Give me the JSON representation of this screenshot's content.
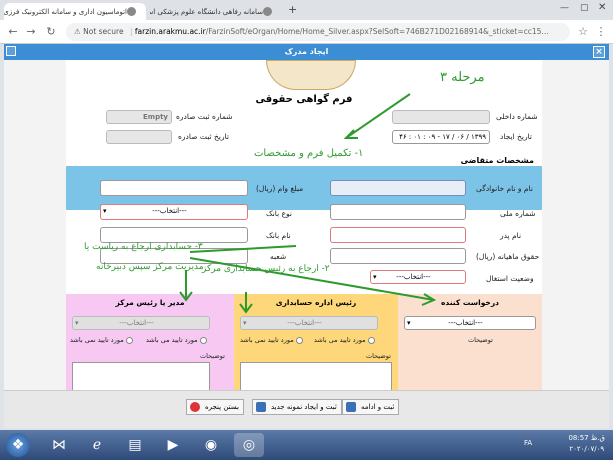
{
  "browser": {
    "tabs": [
      {
        "title": "اتوماسیون اداری و سامانه الکترونیک فرزی…",
        "active": true
      },
      {
        "title": "سامانه رفاهی دانشگاه علوم پزشکی استان م",
        "active": false
      }
    ],
    "new_tab_label": "+",
    "security_label": "Not secure",
    "url_domain": "farzin.arakmu.ac.ir",
    "url_path": "/FarzinSoft/eOrgan/Home/Home_Silver.aspx?SelSoft=746B271D02168914&_sticket=cc15…"
  },
  "dialog": {
    "title": "ایجاد مدرک",
    "form_title": "فرم گواهی حقوقی",
    "fields": {
      "internal_no_label": "شماره داخلی",
      "internal_no_value": "",
      "create_date_label": "تاریخ ایجاد",
      "create_date_value": "۱۳۹۹ / ۰۶ / ۱۷ - ۰۹ : ۰۱ : ۴۶",
      "outgoing_no_label": "شماره ثبت صادره",
      "outgoing_no_value": "Empty",
      "outgoing_date_label": "تاریخ ثبت صادره",
      "outgoing_date_value": ""
    },
    "applicant_section_title": "مشخصات متقاضی",
    "applicant": {
      "name_label": "نام و نام خانوادگی",
      "national_id_label": "شماره ملی",
      "father_label": "نام پدر",
      "salary_label": "حقوق ماهیانه (ریال)",
      "employment_label": "وضعیت استغال",
      "employment_value": "---انتخاب---",
      "loan_label": "مبلغ وام (ریال)",
      "bank_type_label": "نوع بانک",
      "bank_type_value": "---انتخاب---",
      "bank_name_label": "نام بانک",
      "branch_label": "شعبه"
    },
    "panels": [
      {
        "title": "درخواست کننده",
        "select": "---انتخاب---",
        "notes_label": "توضیحات"
      },
      {
        "title": "رئیس اداره حسابداری",
        "select": "---انتخاب---",
        "radio_yes": "مورد تایید می باشد",
        "radio_no": "مورد تایید نمی باشد",
        "notes_label": "توضیحات"
      },
      {
        "title": "مدیر یا رئیس مرکز",
        "select": "---انتخاب---",
        "radio_yes": "مورد تایید می باشد",
        "radio_no": "مورد تایید نمی باشد",
        "notes_label": "توضیحات"
      }
    ],
    "buttons": {
      "save_continue": "ثبت و ادامه",
      "save_new": "ثبت و ایجاد نمونه جدید",
      "close": "بستن پنجره"
    }
  },
  "annotations": {
    "step": "مرحله ۳",
    "a1": "۱- تکمیل فرم و مشخصات",
    "a2": "۲- ارجاع به رئیس حسابداری مرکز",
    "a3": "۳- حسابداری ارجاع به ریاست یا",
    "a3b": "مدیریت مرکز سپس دبیرخانه"
  },
  "taskbar": {
    "lang": "FA",
    "time": "08:57 ق.ظ",
    "date": "۲۰۲۰/۰۷/۰۹"
  },
  "colors": {
    "title_blue": "#3b8ed3",
    "request_bar": "#7cc3e8",
    "panel_requester": "#fbe0d0",
    "panel_accounting": "#fdd77a",
    "panel_manager": "#f7c9f2",
    "annotation_green": "#2e9a2e"
  }
}
